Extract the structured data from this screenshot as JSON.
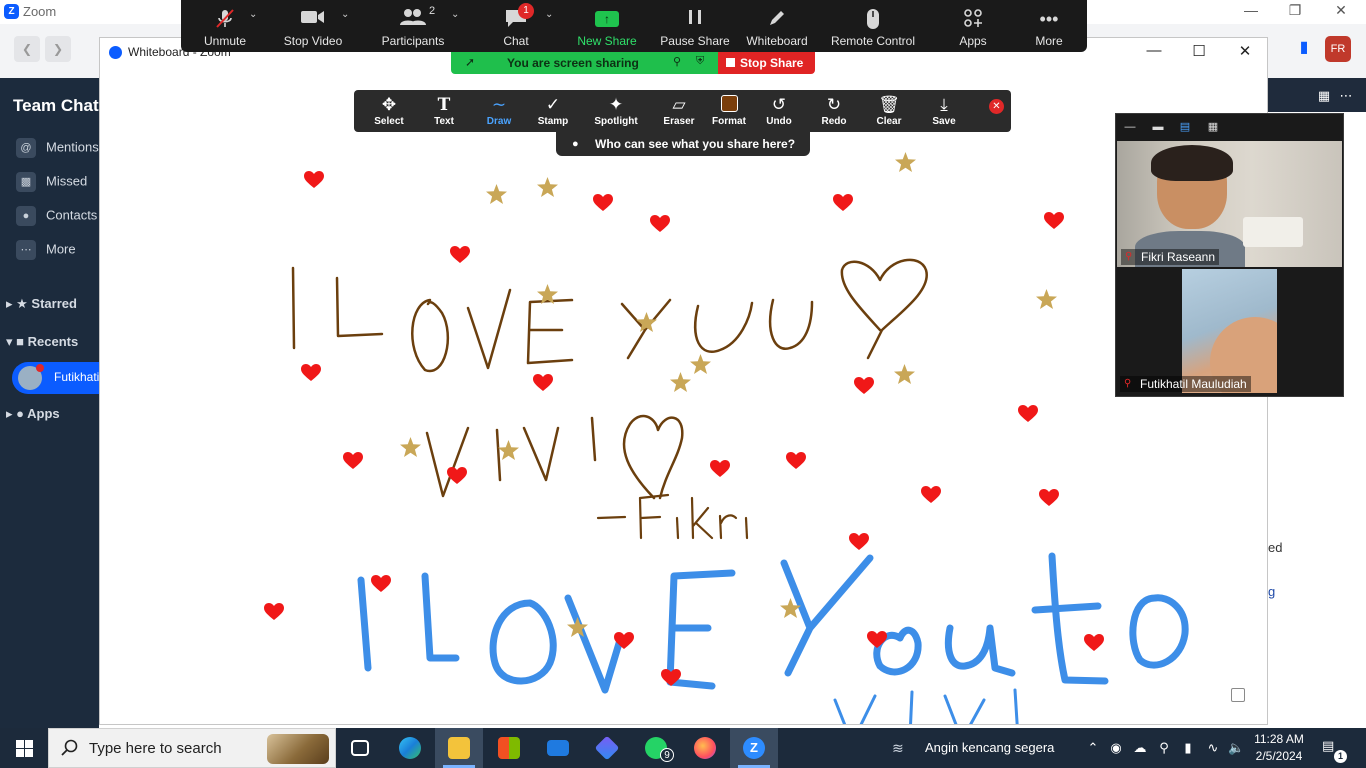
{
  "app": {
    "title": "Zoom",
    "avatar_initials": "FR",
    "right_strip_texts": [
      "ed",
      "g"
    ]
  },
  "sidebar": {
    "title": "Team Chat",
    "items": [
      {
        "label": "Mentions",
        "icon": "at-icon"
      },
      {
        "label": "Missed",
        "icon": "missed-call-icon"
      },
      {
        "label": "Contacts",
        "icon": "contact-icon"
      },
      {
        "label": "More",
        "icon": "more-icon"
      }
    ],
    "sections": [
      "Starred",
      "Recents",
      "Apps"
    ],
    "recent_item": "Futikhatil"
  },
  "whiteboard_window": {
    "title": "Whiteboard - Zoom"
  },
  "share_toolbar": {
    "buttons": [
      {
        "label": "Unmute",
        "icon": "mic-off-icon"
      },
      {
        "label": "Stop Video",
        "icon": "video-camera-icon"
      },
      {
        "label": "Participants",
        "icon": "participants-icon",
        "count": "2"
      },
      {
        "label": "Chat",
        "icon": "chat-icon",
        "badge": "1"
      },
      {
        "label": "New Share",
        "icon": "share-up-arrow-icon"
      },
      {
        "label": "Pause Share",
        "icon": "pause-icon"
      },
      {
        "label": "Whiteboard",
        "icon": "pen-icon"
      },
      {
        "label": "Remote Control",
        "icon": "mouse-icon"
      },
      {
        "label": "Apps",
        "icon": "apps-icon"
      },
      {
        "label": "More",
        "icon": "ellipsis-icon"
      }
    ],
    "sharing_status": "You are screen sharing",
    "stop_share": "Stop Share"
  },
  "annotation_toolbar": {
    "tools": [
      {
        "label": "Select",
        "icon": "move-arrows-icon"
      },
      {
        "label": "Text",
        "icon": "text-t-icon"
      },
      {
        "label": "Draw",
        "icon": "draw-wave-icon",
        "active": true
      },
      {
        "label": "Stamp",
        "icon": "checkmark-stamp-icon"
      },
      {
        "label": "Spotlight",
        "icon": "spotlight-wand-icon"
      },
      {
        "label": "Eraser",
        "icon": "eraser-icon"
      },
      {
        "label": "Format",
        "icon": "format-color-swatch-icon"
      },
      {
        "label": "Undo",
        "icon": "undo-icon"
      },
      {
        "label": "Redo",
        "icon": "redo-icon"
      },
      {
        "label": "Clear",
        "icon": "trash-icon"
      },
      {
        "label": "Save",
        "icon": "save-download-icon"
      }
    ],
    "who_can_see": "Who can see what you share here?",
    "colors": {
      "draw_active": "#4aa3ff",
      "format_swatch": "#7a3e0b"
    }
  },
  "video_panel": {
    "participants": [
      {
        "name": "Fikri Raseann",
        "muted": true
      },
      {
        "name": "Futikhatil Mauludiah",
        "muted": true
      }
    ]
  },
  "canvas": {
    "brown_lines": [
      "I LOVE YOU",
      "VIVI",
      "-Fikri"
    ],
    "blue_lines": [
      "I LOVE You to",
      "-VIVI"
    ],
    "colors": {
      "brown_ink": "#6b3f0e",
      "blue_ink": "#3d8ee8",
      "heart": "#f01818",
      "star": "#c9a757"
    }
  },
  "taskbar": {
    "search_placeholder": "Type here to search",
    "apps": [
      "task-view-icon",
      "edge-icon",
      "file-explorer-icon",
      "store-icon",
      "mail-icon",
      "copilot-icon",
      "whatsapp-icon",
      "firefox-icon",
      "zoom-icon"
    ],
    "whatsapp_badge": "9",
    "weather": "Angin kencang segera",
    "time": "11:28 AM",
    "date": "2/5/2024",
    "notification_count": "1"
  }
}
